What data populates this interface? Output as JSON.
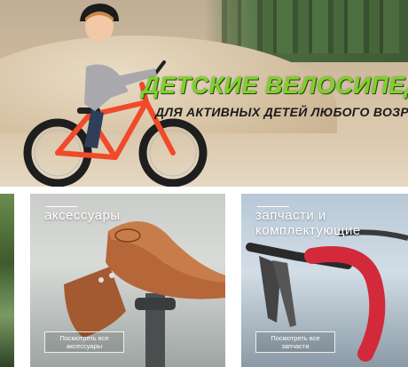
{
  "hero": {
    "title": "ДЕТСКИЕ ВЕЛОСИПЕДЫ",
    "subtitle": "ДЛЯ АКТИВНЫХ ДЕТЕЙ ЛЮБОГО ВОЗРАСТА",
    "title_color": "#7ed12a"
  },
  "categories": [
    {
      "title": "аксессуары",
      "button_label": "Посмотреть все аксессуары"
    },
    {
      "title": "запчасти и комплектующие",
      "button_label": "Посмотреть все запчасти"
    }
  ]
}
